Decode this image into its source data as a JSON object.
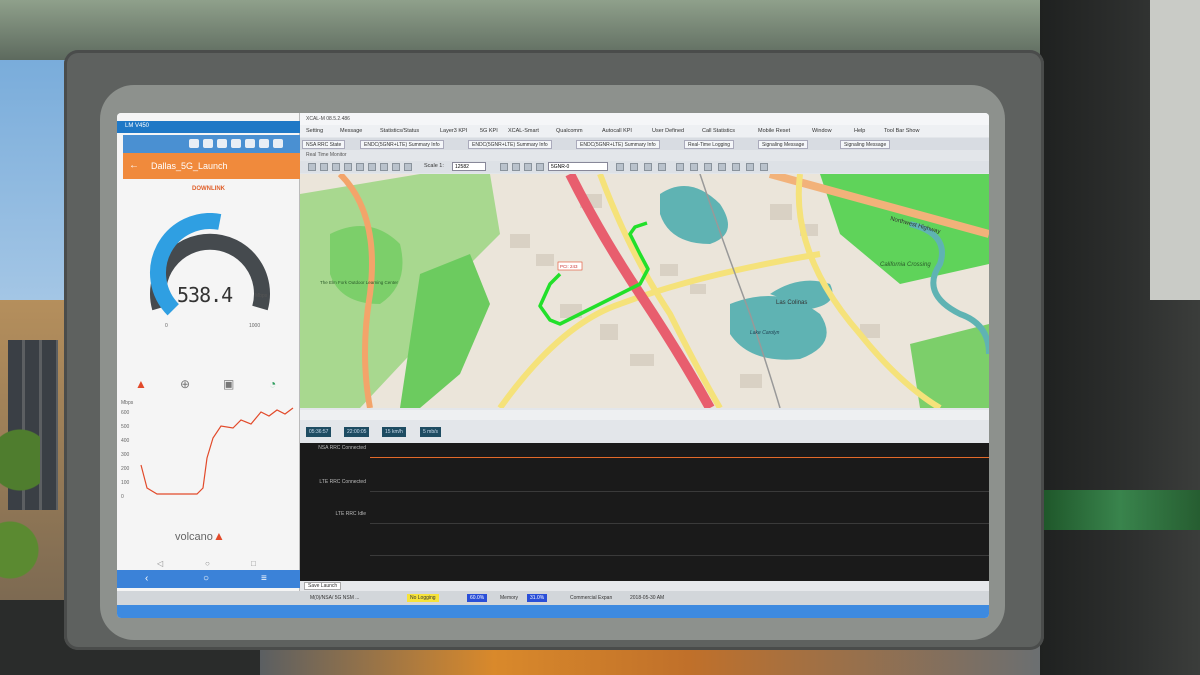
{
  "phone": {
    "app_title": "LM V450",
    "header": "Dallas_5G_Launch",
    "downlink_label": "DOWNLINK",
    "speed_value": "538.4",
    "speed_unit": "Mbps",
    "gauge_min": "0",
    "gauge_max": "1000",
    "gauge_fraction": 0.54,
    "chart_ylabel": "Mbps",
    "chart_yticks": [
      "600",
      "500",
      "400",
      "300",
      "200",
      "100",
      "0"
    ],
    "brand": "volcano"
  },
  "app": {
    "title": "XCAL-M 08.5.2.486",
    "menu": [
      "Setting",
      "Message",
      "Statistics/Status",
      "Layer3 KPI",
      "5G KPI",
      "XCAL-Smart",
      "Qualcomm",
      "Autocall KPI",
      "User Defined",
      "Call Statistics",
      "Mobile Reset",
      "Window",
      "Help",
      "Tool Bar Show"
    ],
    "tabs": [
      "NSA RRC State",
      "ENDC(5GNR+LTE) Summary Info",
      "ENDC(5GNR+LTE) Summary Info",
      "ENDC(5GNR+LTE) Summary Info",
      "Real-Time Logging",
      "Signaling Message",
      "Signaling Message"
    ],
    "realtime_label": "Real Time Monitor",
    "scale_label": "Scale 1:",
    "scale_value": "12582",
    "selector_value": "5GNR-0",
    "map_labels": {
      "northwest_highway": "Northwest Highway",
      "california_crossing": "California Crossing",
      "las_colinas": "Las Colinas",
      "lake_carolyn": "Lake Carolyn",
      "outdoor_center": "The Elm Fork Outdoor Learning Center",
      "marker": "PCI: 243"
    },
    "stats": [
      "05:36:57",
      "22:00:05",
      "15 km/h",
      "5 mb/s"
    ],
    "signal_labels": [
      "NSA RRC Connected",
      "LTE RRC Connected",
      "LTE RRC Idle"
    ],
    "save_tab": "Save Launch",
    "status": {
      "device": "M(0)/NSA/ 5G NSM  ...",
      "logging": "No Logging",
      "cpu": "60.0%",
      "mem_label": "Memory",
      "mem": "31.0%",
      "mode": "Commercial Expan",
      "date": "2018-05-30 AM"
    }
  },
  "colors": {
    "phone_accent": "#f08a3c",
    "phone_blue": "#1f78c6",
    "route": "#22e02a",
    "highway": "#f4a3a3"
  }
}
